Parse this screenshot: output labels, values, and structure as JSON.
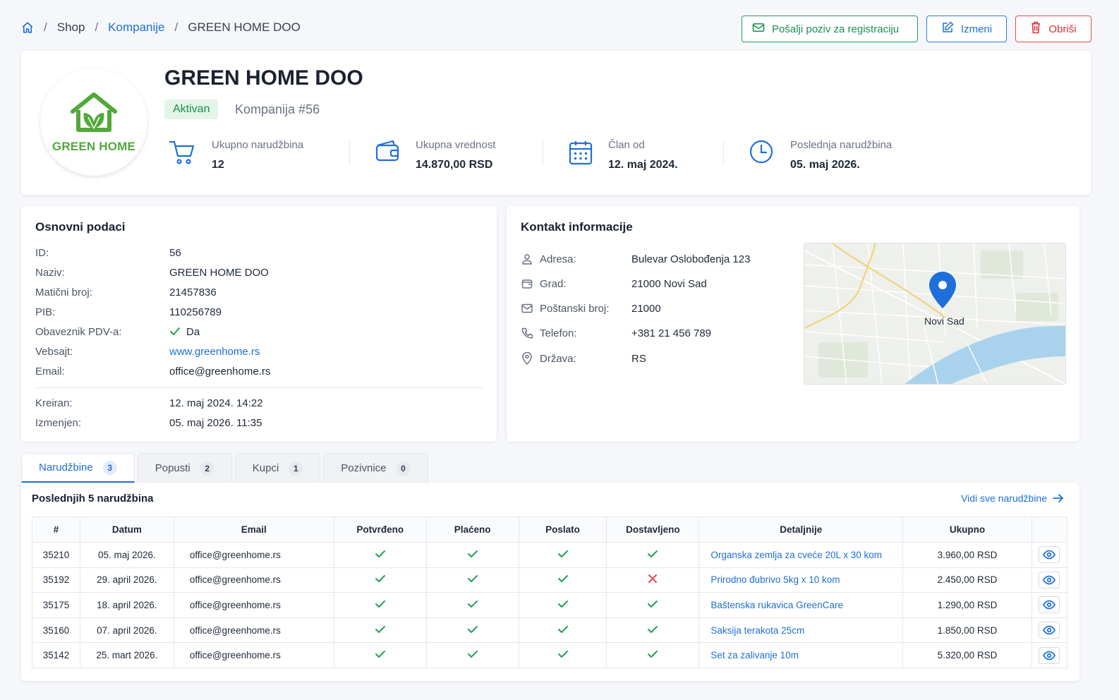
{
  "breadcrumb": {
    "shop": "Shop",
    "companies": "Kompanije",
    "current": "GREEN HOME DOO",
    "sep": "/"
  },
  "actions": {
    "invite": "Pošalji poziv za registraciju",
    "edit": "Izmeni",
    "delete": "Obriši"
  },
  "company": {
    "name": "GREEN HOME DOO",
    "logo_text": "GREEN HOME",
    "status": "Aktivan",
    "number": "Kompanija #56"
  },
  "stats": {
    "orders_label": "Ukupno narudžbina",
    "orders_value": "12",
    "total_label": "Ukupna vrednost",
    "total_value": "14.870,00 RSD",
    "member_label": "Član od",
    "member_value": "12. maj 2024.",
    "last_label": "Poslednja narudžbina",
    "last_value": "05. maj 2026."
  },
  "basic": {
    "title": "Osnovni podaci",
    "rows": [
      {
        "k": "ID:",
        "v": "56"
      },
      {
        "k": "Naziv:",
        "v": "GREEN HOME DOO"
      },
      {
        "k": "Matični broj:",
        "v": "21457836"
      },
      {
        "k": "PIB:",
        "v": "110256789"
      },
      {
        "k": "Obaveznik PDV-a:",
        "v": "Da"
      },
      {
        "k": "Vebsajt:",
        "v": "www.greenhome.rs"
      },
      {
        "k": "Email:",
        "v": "office@greenhome.rs"
      }
    ],
    "created_label": "Kreiran:",
    "created_value": "12. maj 2024. 14:22",
    "modified_label": "Izmenjen:",
    "modified_value": "05. maj 2026. 11:35"
  },
  "contact": {
    "title": "Kontakt informacije",
    "rows": [
      {
        "k": "Adresa:",
        "v": "Bulevar Oslobođenja 123",
        "icon": "person-icon"
      },
      {
        "k": "Grad:",
        "v": "21000 Novi Sad",
        "icon": "wallet-icon"
      },
      {
        "k": "Poštanski broj:",
        "v": "21000",
        "icon": "mail-icon"
      },
      {
        "k": "Telefon:",
        "v": "+381 21 456 789",
        "icon": "phone-icon"
      },
      {
        "k": "Država:",
        "v": "RS",
        "icon": "location-icon"
      }
    ],
    "map_label": "Novi Sad"
  },
  "tabs": [
    {
      "label": "Narudžbine",
      "count": "3"
    },
    {
      "label": "Popusti",
      "count": "2"
    },
    {
      "label": "Kupci",
      "count": "1"
    },
    {
      "label": "Pozivnice",
      "count": "0"
    }
  ],
  "orders": {
    "title": "Poslednjih 5 narudžbina",
    "see_all": "Vidi sve narudžbine",
    "columns": [
      "#",
      "Datum",
      "Email",
      "Potvrđeno",
      "Plaćeno",
      "Poslato",
      "Dostavljeno",
      "Detaljnije",
      "Ukupno",
      ""
    ],
    "rows": [
      {
        "id": "35210",
        "date": "05. maj 2026.",
        "email": "office@greenhome.rs",
        "confirmed": true,
        "paid": true,
        "shipped": true,
        "delivered": true,
        "details": "Organska zemlja za cveće 20L x 30 kom",
        "total": "3.960,00 RSD"
      },
      {
        "id": "35192",
        "date": "29. april 2026.",
        "email": "office@greenhome.rs",
        "confirmed": true,
        "paid": true,
        "shipped": true,
        "delivered": false,
        "details": "Prirodno đubrivo 5kg x 10 kom",
        "total": "2.450,00 RSD"
      },
      {
        "id": "35175",
        "date": "18. april 2026.",
        "email": "office@greenhome.rs",
        "confirmed": true,
        "paid": true,
        "shipped": true,
        "delivered": true,
        "details": "Baštenska rukavica GreenCare",
        "total": "1.290,00 RSD"
      },
      {
        "id": "35160",
        "date": "07. april 2026.",
        "email": "office@greenhome.rs",
        "confirmed": true,
        "paid": true,
        "shipped": true,
        "delivered": true,
        "details": "Saksija terakota 25cm",
        "total": "1.850,00 RSD"
      },
      {
        "id": "35142",
        "date": "25. mart 2026.",
        "email": "office@greenhome.rs",
        "confirmed": true,
        "paid": true,
        "shipped": true,
        "delivered": true,
        "details": "Set za zalivanje 10m",
        "total": "5.320,00 RSD"
      }
    ]
  },
  "colors": {
    "primary": "#1e6fd9",
    "success": "#22a05a",
    "danger": "#e5484d",
    "logo_green": "#52a83a"
  }
}
